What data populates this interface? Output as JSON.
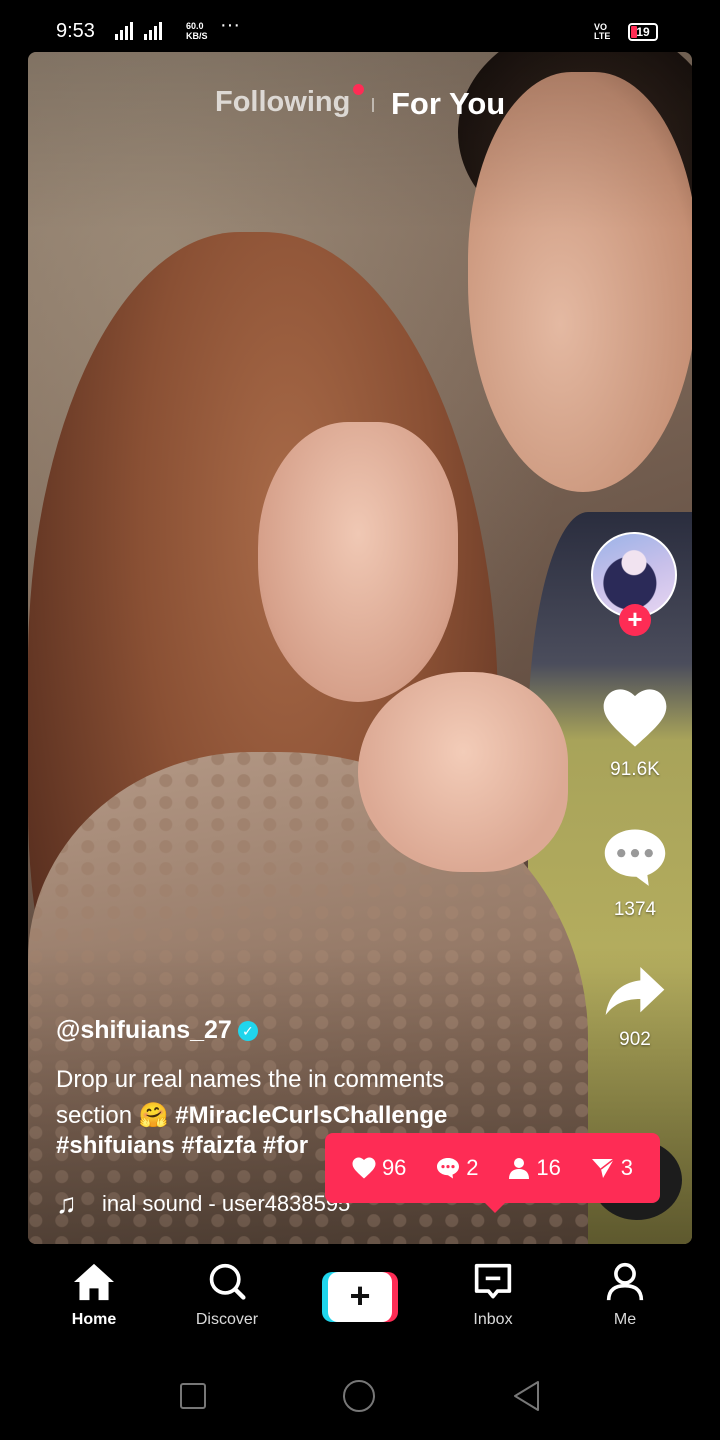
{
  "status_bar": {
    "time": "9:53",
    "network_type": "4G",
    "speed_value": "60.0",
    "speed_unit": "KB/S",
    "more": "···",
    "volte_line1": "VO",
    "volte_line2": "LTE",
    "battery_level": "19",
    "battery_color": "#ff2d55"
  },
  "top_tabs": {
    "following": "Following",
    "for_you": "For You",
    "selected": "For You"
  },
  "actions": {
    "likes": "91.6K",
    "comments": "1374",
    "shares": "902",
    "follow_icon": "plus-icon"
  },
  "post": {
    "username": "@shifuians_27",
    "desc_text": "Drop ur real names the in comments section",
    "emoji": "🤗",
    "hashtag1": "#MiracleCurlsChallenge",
    "line3": "#shifuians #faizfa #for",
    "sound": "inal sound - user4838595"
  },
  "stats_popup": {
    "likes": "96",
    "comments": "2",
    "followers": "16",
    "shares": "3"
  },
  "bottom_nav": {
    "home": "Home",
    "discover": "Discover",
    "inbox": "Inbox",
    "me": "Me",
    "create": "+",
    "active": "Home"
  },
  "colors": {
    "accent": "#fe2c55",
    "cyan": "#20d5ec"
  }
}
